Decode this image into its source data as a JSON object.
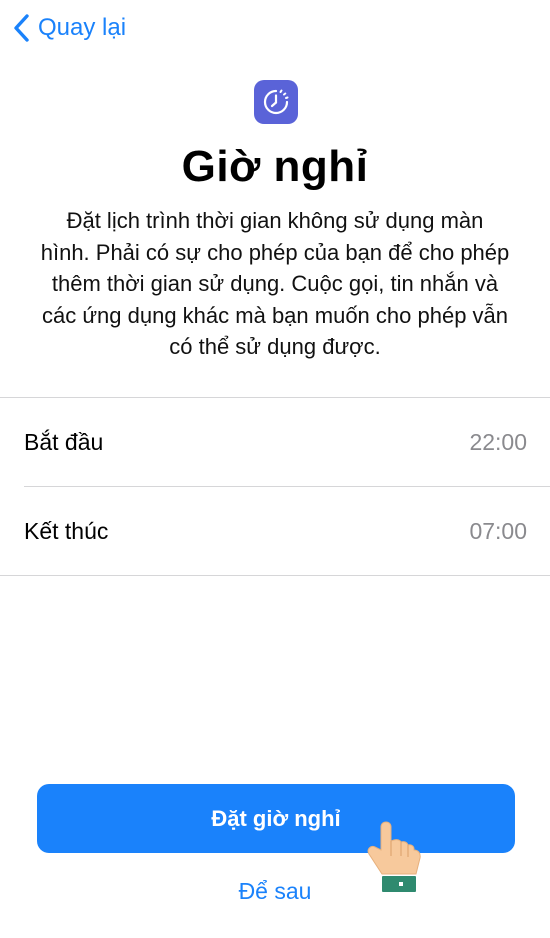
{
  "nav": {
    "back_label": "Quay lại"
  },
  "header": {
    "icon": "downtime-icon",
    "title": "Giờ nghỉ",
    "description": "Đặt lịch trình thời gian không sử dụng màn hình. Phải có sự cho phép của bạn để cho phép thêm thời gian sử dụng. Cuộc gọi, tin nhắn và các ứng dụng khác mà bạn muốn cho phép vẫn có thể sử dụng được."
  },
  "schedule": {
    "rows": [
      {
        "label": "Bắt đầu",
        "value": "22:00"
      },
      {
        "label": "Kết thúc",
        "value": "07:00"
      }
    ]
  },
  "actions": {
    "primary_label": "Đặt giờ nghỉ",
    "secondary_label": "Để sau"
  },
  "colors": {
    "accent": "#1a82fb",
    "icon_bg": "#5a63d8",
    "secondary_text": "#8a8a8e",
    "separator": "#d6d6d8"
  }
}
